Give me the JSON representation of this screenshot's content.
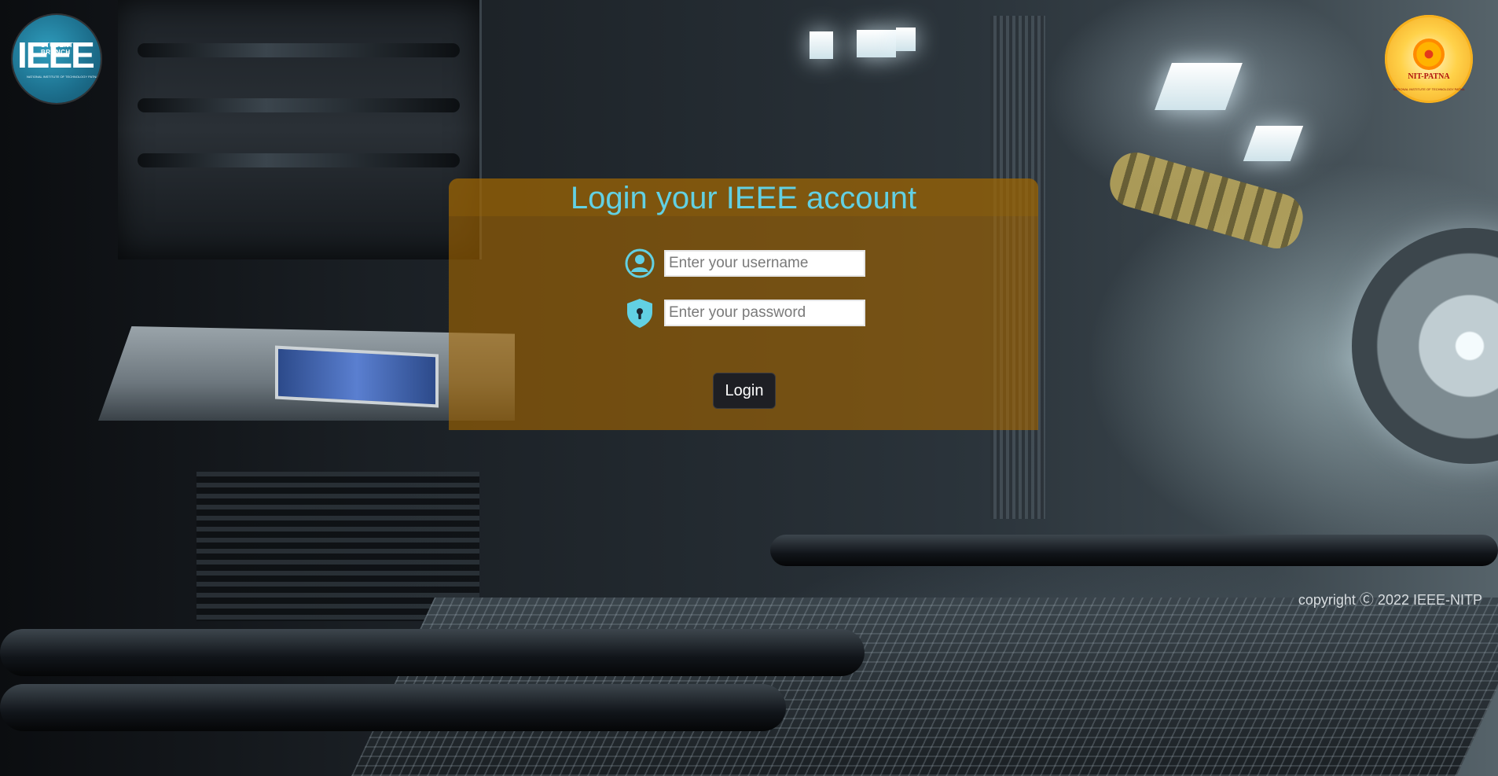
{
  "brand": {
    "ieee_logo": {
      "mark": "IEEE",
      "subtitle": "STUDENT BRANCH",
      "tagline": "NATIONAL INSTITUTE OF TECHNOLOGY PATNA"
    },
    "nitp_logo": {
      "name": "NIT-PATNA",
      "ring_text": "NATIONAL INSTITUTE OF TECHNOLOGY PATNA"
    }
  },
  "login": {
    "title": "Login your IEEE account",
    "username": {
      "value": "",
      "placeholder": "Enter your username",
      "icon": "user-circle-icon"
    },
    "password": {
      "value": "",
      "placeholder": "Enter your password",
      "icon": "shield-lock-icon"
    },
    "submit_label": "Login"
  },
  "footer": {
    "copyright": "copyright Ⓒ 2022 IEEE-NITP"
  },
  "colors": {
    "title": "#62d0e3",
    "icon": "#62d0e3",
    "panel": "rgba(165,102,0,0.62)",
    "button_bg": "#1e1f24",
    "button_text": "#ffffff",
    "copyright": "#d8dde0"
  }
}
